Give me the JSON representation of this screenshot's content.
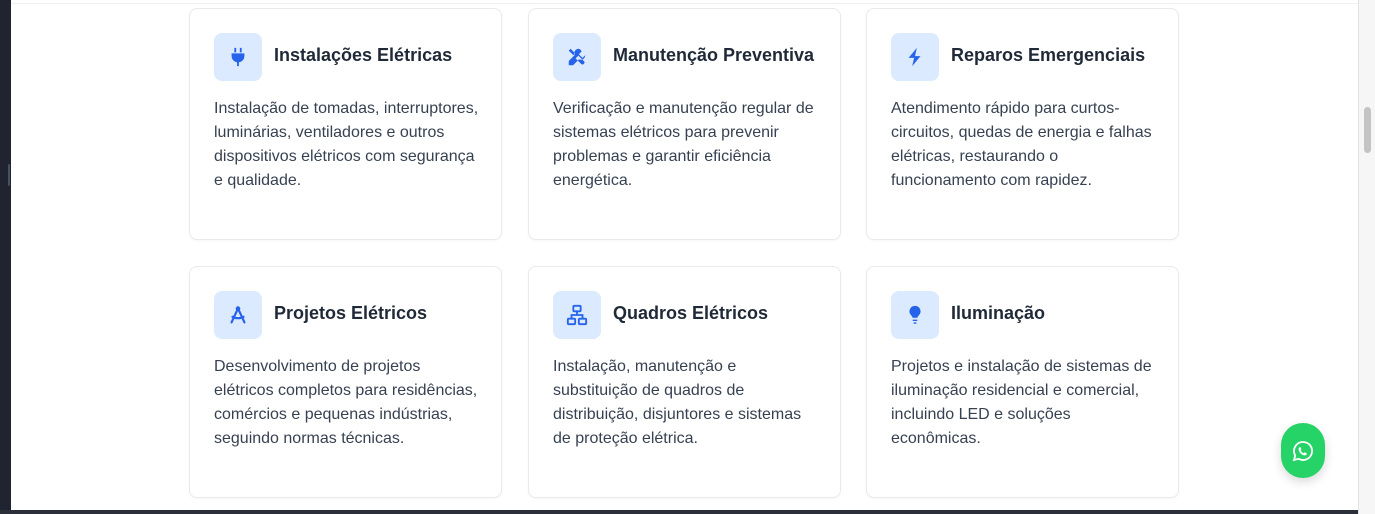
{
  "colors": {
    "accent": "#2563eb",
    "icon_bg": "#dbeafe",
    "whatsapp": "#25d366"
  },
  "services": [
    {
      "icon": "plug-icon",
      "title": "Instalações Elétricas",
      "description": "Instalação de tomadas, interruptores, luminárias, ventiladores e outros dispositivos elétricos com segurança e qualidade."
    },
    {
      "icon": "tools-icon",
      "title": "Manutenção Preventiva",
      "description": "Verificação e manutenção regular de sistemas elétricos para prevenir problemas e garantir eficiência energética."
    },
    {
      "icon": "bolt-icon",
      "title": "Reparos Emergenciais",
      "description": "Atendimento rápido para curtos-circuitos, quedas de energia e falhas elétricas, restaurando o funcionamento com rapidez."
    },
    {
      "icon": "compass-drafting-icon",
      "title": "Projetos Elétricos",
      "description": "Desenvolvimento de projetos elétricos completos para residências, comércios e pequenas indústrias, seguindo normas técnicas."
    },
    {
      "icon": "network-icon",
      "title": "Quadros Elétricos",
      "description": "Instalação, manutenção e substituição de quadros de distribuição, disjuntores e sistemas de proteção elétrica."
    },
    {
      "icon": "lightbulb-icon",
      "title": "Iluminação",
      "description": "Projetos e instalação de sistemas de iluminação residencial e comercial, incluindo LED e soluções econômicas."
    }
  ],
  "floating_button": {
    "icon": "whatsapp-icon"
  }
}
